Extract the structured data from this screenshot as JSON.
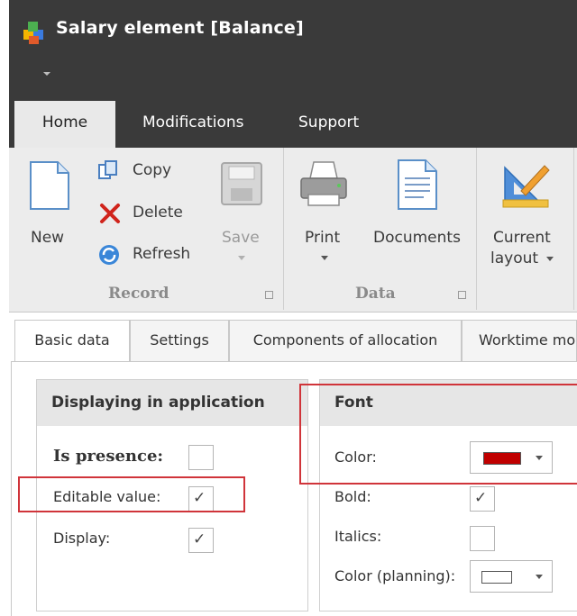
{
  "window": {
    "title": "Salary element [Balance]"
  },
  "ribbon_tabs": [
    {
      "label": "Home",
      "active": true
    },
    {
      "label": "Modifications",
      "active": false
    },
    {
      "label": "Support",
      "active": false
    }
  ],
  "ribbon": {
    "record": {
      "label": "Record",
      "new_label": "New",
      "copy_label": "Copy",
      "delete_label": "Delete",
      "refresh_label": "Refresh",
      "save_label": "Save"
    },
    "data": {
      "label": "Data",
      "print_label": "Print",
      "documents_label": "Documents"
    },
    "layout": {
      "current_line1": "Current",
      "current_line2": "layout"
    }
  },
  "content_tabs": [
    {
      "label": "Basic data",
      "active": true
    },
    {
      "label": "Settings",
      "active": false
    },
    {
      "label": "Components of allocation",
      "active": false
    },
    {
      "label": "Worktime mo",
      "active": false
    }
  ],
  "display_group": {
    "title": "Displaying in application",
    "fields": [
      {
        "label": "Is presence:",
        "checked": false
      },
      {
        "label": "Editable value:",
        "checked": true
      },
      {
        "label": "Display:",
        "checked": true
      }
    ]
  },
  "font_group": {
    "title": "Font",
    "color_label": "Color:",
    "color_value": "#c00000",
    "bold_label": "Bold:",
    "bold_checked": true,
    "italics_label": "Italics:",
    "italics_checked": false,
    "planning_color_label": "Color (planning):",
    "planning_color_value": "#ffffff"
  },
  "check_mark": "✓",
  "colors": {
    "title_bar": "#3a3a3a",
    "ribbon_bg": "#ececec",
    "highlight": "#d0343a"
  }
}
